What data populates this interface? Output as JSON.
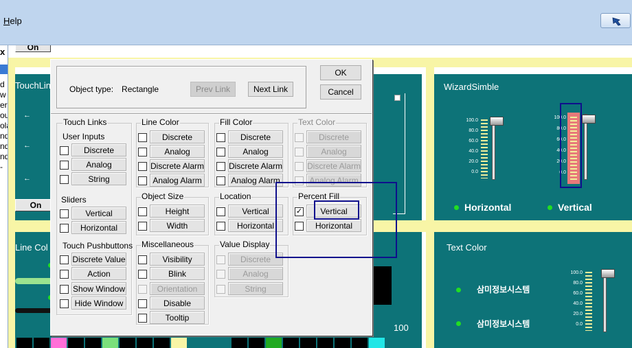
{
  "menubar": {
    "help_accel": "H",
    "help_rest": "elp"
  },
  "left_strip": {
    "close": "x",
    "letters": [
      "d",
      "w",
      "er",
      "ou",
      "ola",
      "nd",
      "nd",
      "nd",
      "-"
    ]
  },
  "canvas": {
    "on_label": "On",
    "touch_links_title": "TouchLin",
    "line_color_title": "Line Col",
    "wizard_title": "WizardSimble",
    "text_color_title": "Text Color",
    "horizontal_legend": "Horizontal",
    "vertical_legend": "Vertical",
    "korean_label": "삼미정보시스템",
    "scale_labels": [
      "100.0",
      "80.0",
      "60.0",
      "40.0",
      "20.0",
      "0.0"
    ],
    "value_100": "100",
    "arrow_glyph": "←",
    "palette_left": [
      "#000000",
      "#000000",
      "#ff6fd8",
      "#000000",
      "#000000",
      "#7be07b",
      "#000000",
      "#000000",
      "#000000",
      "#f8f5a6"
    ],
    "palette_right": [
      "#000000",
      "#000000",
      "#22aa22",
      "#000000",
      "#000000",
      "#000000",
      "#000000",
      "#000000",
      "#22e6e6"
    ]
  },
  "dialog": {
    "object_type_label": "Object type:",
    "object_type_value": "Rectangle",
    "prev_link": "Prev Link",
    "next_link": "Next Link",
    "ok": "OK",
    "cancel": "Cancel",
    "touch_links": {
      "title": "Touch Links",
      "user_inputs": "User Inputs",
      "discrete": "Discrete",
      "analog": "Analog",
      "string": "String",
      "sliders": "Sliders",
      "vertical": "Vertical",
      "horizontal": "Horizontal",
      "touch_pushbuttons": "Touch Pushbuttons",
      "discrete_value": "Discrete Value",
      "action": "Action",
      "show_window": "Show Window",
      "hide_window": "Hide Window"
    },
    "line_color": {
      "title": "Line Color",
      "discrete": "Discrete",
      "analog": "Analog",
      "discrete_alarm": "Discrete Alarm",
      "analog_alarm": "Analog Alarm"
    },
    "fill_color": {
      "title": "Fill Color",
      "discrete": "Discrete",
      "analog": "Analog",
      "discrete_alarm": "Discrete Alarm",
      "analog_alarm": "Analog Alarm"
    },
    "text_color": {
      "title": "Text Color",
      "discrete": "Discrete",
      "analog": "Analog",
      "discrete_alarm": "Discrete Alarm",
      "analog_alarm": "Analog Alarm"
    },
    "object_size": {
      "title": "Object Size",
      "height": "Height",
      "width": "Width"
    },
    "location": {
      "title": "Location",
      "vertical": "Vertical",
      "horizontal": "Horizontal"
    },
    "percent_fill": {
      "title": "Percent Fill",
      "vertical": "Vertical",
      "horizontal": "Horizontal",
      "vertical_checked": true
    },
    "miscellaneous": {
      "title": "Miscellaneous",
      "visibility": "Visibility",
      "blink": "Blink",
      "orientation": "Orientation",
      "disable": "Disable",
      "tooltip": "Tooltip"
    },
    "value_display": {
      "title": "Value Display",
      "discrete": "Discrete",
      "analog": "Analog",
      "string": "String"
    }
  }
}
